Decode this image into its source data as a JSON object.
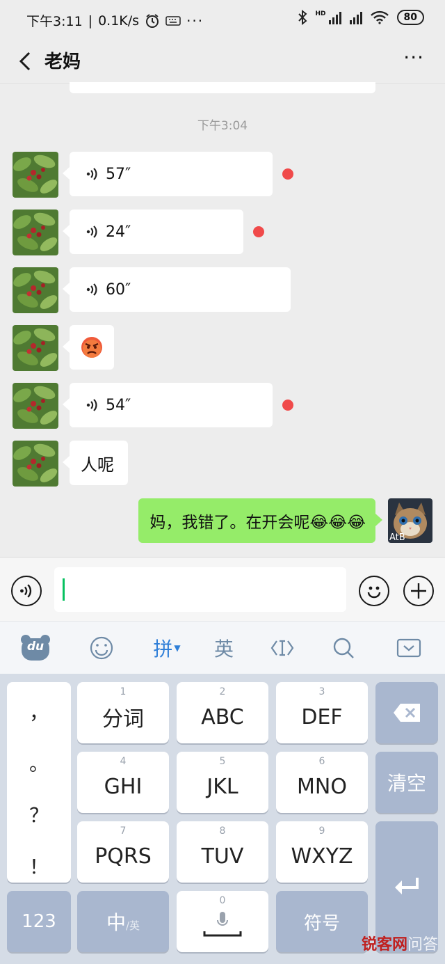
{
  "status_bar": {
    "time": "下午3:11",
    "speed": "0.1K/s",
    "battery": "80",
    "network_label": "HD"
  },
  "header": {
    "title": "老妈",
    "more": "···"
  },
  "chat": {
    "timestamp": "下午3:04",
    "messages": [
      {
        "type": "voice",
        "duration": "57″",
        "unread": true
      },
      {
        "type": "voice",
        "duration": "24″",
        "unread": true
      },
      {
        "type": "voice",
        "duration": "60″",
        "unread": false
      },
      {
        "type": "emoji",
        "emoji": "😡"
      },
      {
        "type": "voice",
        "duration": "54″",
        "unread": true
      },
      {
        "type": "text",
        "text": "人呢"
      }
    ],
    "my_message": "妈，我错了。在开会呢😂😂😂",
    "my_avatar_label": "AtB"
  },
  "ime_toolbar": {
    "pinyin": "拼",
    "english": "英",
    "logo": "du"
  },
  "keyboard": {
    "punctuation": [
      "，",
      "。",
      "？",
      "！"
    ],
    "keys": [
      {
        "num": "1",
        "label": "分词"
      },
      {
        "num": "2",
        "label": "ABC"
      },
      {
        "num": "3",
        "label": "DEF"
      },
      {
        "num": "4",
        "label": "GHI"
      },
      {
        "num": "5",
        "label": "JKL"
      },
      {
        "num": "6",
        "label": "MNO"
      },
      {
        "num": "7",
        "label": "PQRS"
      },
      {
        "num": "8",
        "label": "TUV"
      },
      {
        "num": "9",
        "label": "WXYZ"
      }
    ],
    "clear": "清空",
    "num_switch": "123",
    "lang_main": "中",
    "lang_sub": "/英",
    "space_num": "0",
    "symbols": "符号"
  },
  "watermark": {
    "brand": "锐客网",
    "suffix": "问答"
  }
}
